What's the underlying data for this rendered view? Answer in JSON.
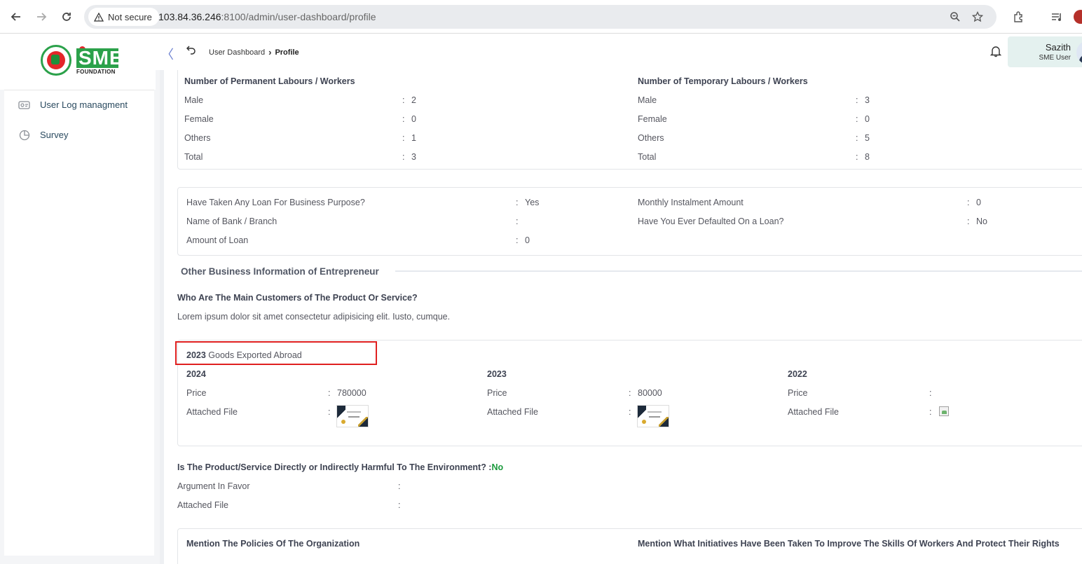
{
  "browser": {
    "security_label": "Not secure",
    "url_host": "103.84.36.246",
    "url_path": ":8100/admin/user-dashboard/profile"
  },
  "brand": {
    "logo_text": "SME",
    "logo_subtext": "FOUNDATION"
  },
  "sidebar": {
    "items": [
      {
        "label": "User Log managment",
        "icon": "log-icon"
      },
      {
        "label": "Survey",
        "icon": "pie-chart-icon"
      }
    ]
  },
  "breadcrumb": {
    "parent": "User Dashboard",
    "separator": "›",
    "current": "Profile"
  },
  "user": {
    "name": "Sazith",
    "role": "SME User"
  },
  "labours": {
    "permanent": {
      "title": "Number of Permanent Labours / Workers",
      "rows": [
        {
          "label": "Male",
          "value": "2"
        },
        {
          "label": "Female",
          "value": "0"
        },
        {
          "label": "Others",
          "value": "1"
        },
        {
          "label": "Total",
          "value": "3"
        }
      ]
    },
    "temporary": {
      "title": "Number of Temporary Labours / Workers",
      "rows": [
        {
          "label": "Male",
          "value": "3"
        },
        {
          "label": "Female",
          "value": "0"
        },
        {
          "label": "Others",
          "value": "5"
        },
        {
          "label": "Total",
          "value": "8"
        }
      ]
    }
  },
  "loan": {
    "left": [
      {
        "label": "Have Taken Any Loan For Business Purpose?",
        "value": "Yes"
      },
      {
        "label": "Name of Bank / Branch",
        "value": ""
      },
      {
        "label": "Amount of Loan",
        "value": "0"
      }
    ],
    "right": [
      {
        "label": "Monthly Instalment Amount",
        "value": "0"
      },
      {
        "label": "Have You Ever Defaulted On a Loan?",
        "value": "No"
      }
    ]
  },
  "other_info": {
    "section_title": "Other Business Information of Entrepreneur",
    "customers_question": "Who Are The Main Customers of The Product Or Service?",
    "customers_answer": "Lorem ipsum dolor sit amet consectetur adipisicing elit. Iusto, cumque."
  },
  "exports": {
    "title_year": "2023",
    "title_text": "Goods Exported Abroad",
    "price_label": "Price",
    "file_label": "Attached File",
    "years": [
      {
        "year": "2024",
        "price": "780000"
      },
      {
        "year": "2023",
        "price": "80000"
      },
      {
        "year": "2022",
        "price": ""
      }
    ]
  },
  "environment": {
    "question": "Is The Product/Service Directly or Indirectly Harmful To The Environment? :",
    "answer": "No",
    "argument_label": "Argument In Favor",
    "file_label": "Attached File"
  },
  "policies": {
    "left_title": "Mention The Policies Of The Organization",
    "right_title": "Mention What Initiatives Have Been Taken To Improve The Skills Of Workers And Protect Their Rights"
  },
  "colon": ":"
}
